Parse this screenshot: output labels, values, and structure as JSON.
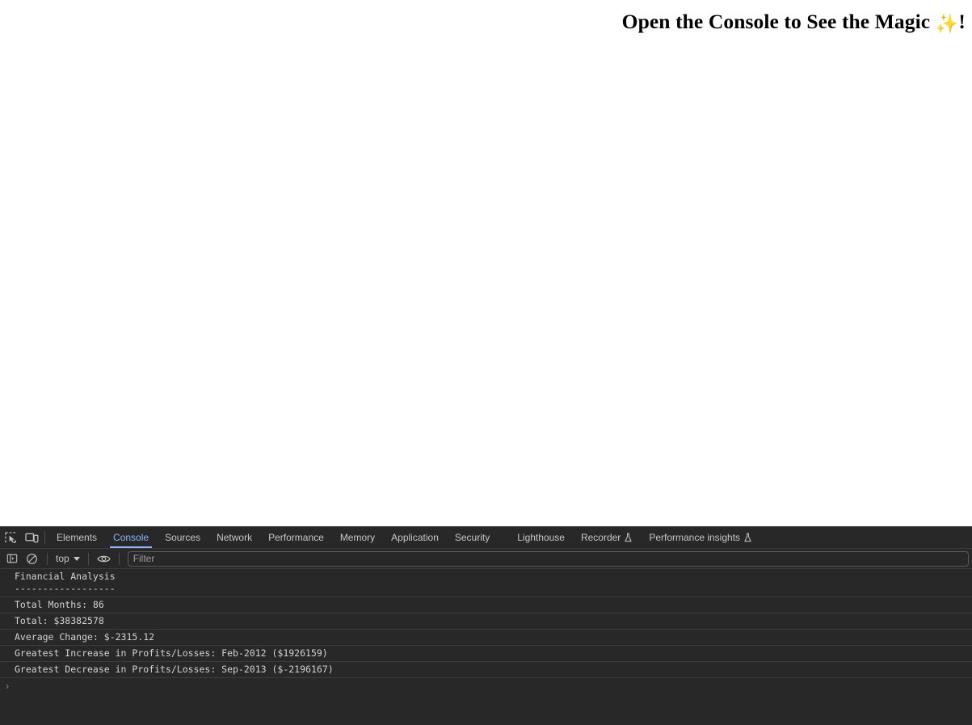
{
  "page": {
    "heading_text": "Open the Console to See the Magic ",
    "heading_emoji": "✨",
    "heading_suffix": "!",
    "background_color": "#ffffff",
    "text_color": "#000000"
  },
  "devtools": {
    "background_color": "#282828",
    "accent_color": "#8ab4f8",
    "tabbar": {
      "inspect_icon": "inspect-element-icon",
      "device_toolbar_icon": "device-toolbar-icon",
      "tabs": [
        {
          "label": "Elements",
          "active": false,
          "experimental": false
        },
        {
          "label": "Console",
          "active": true,
          "experimental": false
        },
        {
          "label": "Sources",
          "active": false,
          "experimental": false
        },
        {
          "label": "Network",
          "active": false,
          "experimental": false
        },
        {
          "label": "Performance",
          "active": false,
          "experimental": false
        },
        {
          "label": "Memory",
          "active": false,
          "experimental": false
        },
        {
          "label": "Application",
          "active": false,
          "experimental": false
        },
        {
          "label": "Security",
          "active": false,
          "experimental": false
        }
      ],
      "tabs_secondary": [
        {
          "label": "Lighthouse",
          "active": false,
          "experimental": false
        },
        {
          "label": "Recorder",
          "active": false,
          "experimental": true,
          "flask": "⚗"
        },
        {
          "label": "Performance insights",
          "active": false,
          "experimental": true,
          "flask": "⚗"
        }
      ]
    },
    "console_toolbar": {
      "sidebar_toggle_icon": "console-sidebar-toggle-icon",
      "clear_console_icon": "clear-console-icon",
      "context_value": "top",
      "eye_icon": "live-expression-eye-icon",
      "filter_placeholder": "Filter",
      "filter_value": ""
    },
    "console_messages": [
      {
        "text": "Financial Analysis\n------------------"
      },
      {
        "text": "Total Months: 86"
      },
      {
        "text": "Total: $38382578"
      },
      {
        "text": "Average Change: $-2315.12"
      },
      {
        "text": "Greatest Increase in Profits/Losses: Feb-2012 ($1926159)"
      },
      {
        "text": "Greatest Decrease in Profits/Losses: Sep-2013 ($-2196167)"
      }
    ],
    "prompt": {
      "arrow": "›",
      "value": ""
    }
  }
}
